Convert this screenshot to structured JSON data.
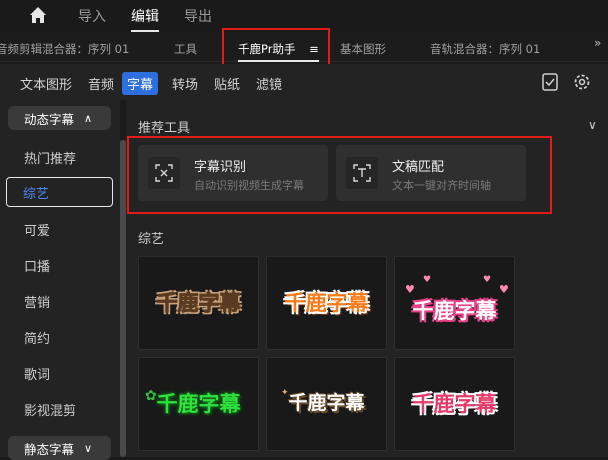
{
  "topbar": {
    "home_icon": "home-icon",
    "nav": [
      "导入",
      "编辑",
      "导出"
    ],
    "active_index": 1
  },
  "panel_tabs": {
    "items": [
      "音频剪辑混合器：序列 01",
      "工具",
      "千鹿Pr助手",
      "基本图形",
      "音轨混合器：序列 01"
    ],
    "active_index": 2,
    "menu_icon": "hamburger-icon",
    "overflow_icon": "double-chevron-right-icon"
  },
  "subtabs": {
    "items": [
      "文本图形",
      "音频",
      "字幕",
      "转场",
      "贴纸",
      "滤镜"
    ],
    "active_index": 2,
    "right_icons": [
      "checklist-icon",
      "gear-icon"
    ],
    "accent": "#2e6fe0"
  },
  "sidebar": {
    "header": "动态字幕",
    "items": [
      "热门推荐",
      "综艺",
      "可爱",
      "口播",
      "营销",
      "简约",
      "歌词",
      "影视混剪"
    ],
    "active_index": 1,
    "footer": "静态字幕"
  },
  "main": {
    "recommend_title": "推荐工具",
    "tools": [
      {
        "name": "字幕识别",
        "desc": "自动识别视频生成字幕",
        "icon": "subtitle-recognition-icon"
      },
      {
        "name": "文稿匹配",
        "desc": "文本一键对齐时间轴",
        "icon": "text-match-icon"
      }
    ],
    "variety_title": "综艺",
    "tiles": [
      {
        "text": "千鹿字幕",
        "style": "white-brown-outline"
      },
      {
        "text": "千鹿字幕",
        "style": "orange-white-outline"
      },
      {
        "text": "千鹿字幕",
        "style": "pink-hearts"
      },
      {
        "text": "千鹿字幕",
        "style": "green-glow"
      },
      {
        "text": "千鹿字幕",
        "style": "white-brown-sparkle"
      },
      {
        "text": "千鹿字幕",
        "style": "pink-white-outline"
      }
    ]
  },
  "highlight_color": "#e21a1a"
}
